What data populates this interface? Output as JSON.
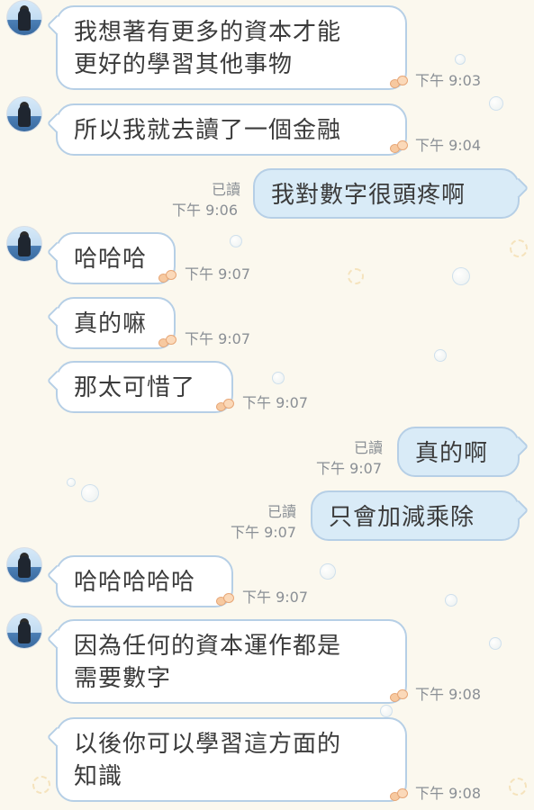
{
  "messages": [
    {
      "text": "我想著有更多的資本才能\n更好的學習其他事物",
      "time": "下午 9:03"
    },
    {
      "text": "所以我就去讀了一個金融",
      "time": "下午 9:04"
    },
    {
      "text": "我對數字很頭疼啊",
      "time": "下午 9:06",
      "read": "已讀"
    },
    {
      "text": "哈哈哈",
      "time": "下午 9:07"
    },
    {
      "text": "真的嘛",
      "time": "下午 9:07"
    },
    {
      "text": "那太可惜了",
      "time": "下午 9:07"
    },
    {
      "text": "真的啊",
      "time": "下午 9:07",
      "read": "已讀"
    },
    {
      "text": "只會加減乘除",
      "time": "下午 9:07",
      "read": "已讀"
    },
    {
      "text": "哈哈哈哈哈",
      "time": "下午 9:07"
    },
    {
      "text": "因為任何的資本運作都是\n需要數字",
      "time": "下午 9:08"
    },
    {
      "text": "以後你可以學習這方面的\n知識",
      "time": "下午 9:08"
    }
  ],
  "colors": {
    "background": "#fbf8ee",
    "incoming_bubble": "#ffffff",
    "outgoing_bubble": "#d9ebf7",
    "bubble_border": "#b6cfe6",
    "timestamp": "#8a8f95"
  }
}
